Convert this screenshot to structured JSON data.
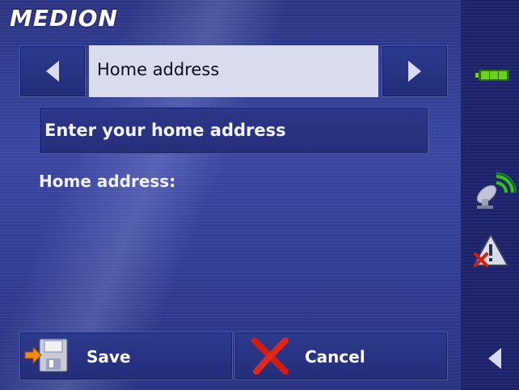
{
  "brand": {
    "name": "MEDION"
  },
  "header": {
    "title": "Home address",
    "prev_icon": "arrow-left-icon",
    "next_icon": "arrow-right-icon"
  },
  "prompt": {
    "label": "Enter your home address"
  },
  "field": {
    "label": "Home address:"
  },
  "actions": {
    "save_label": "Save",
    "save_icon": "save-disk-icon",
    "cancel_label": "Cancel",
    "cancel_icon": "cancel-x-icon"
  },
  "sidebar": {
    "battery_icon": "battery-icon",
    "gps_icon": "gps-satellite-icon",
    "warning_icon": "warning-off-icon",
    "back_icon": "back-arrow-icon"
  },
  "colors": {
    "background": "#2c3584",
    "title_box": "#d8dcec",
    "cancel_red": "#d61a10",
    "battery_green": "#6ad21c",
    "gps_green": "#33c21a"
  }
}
